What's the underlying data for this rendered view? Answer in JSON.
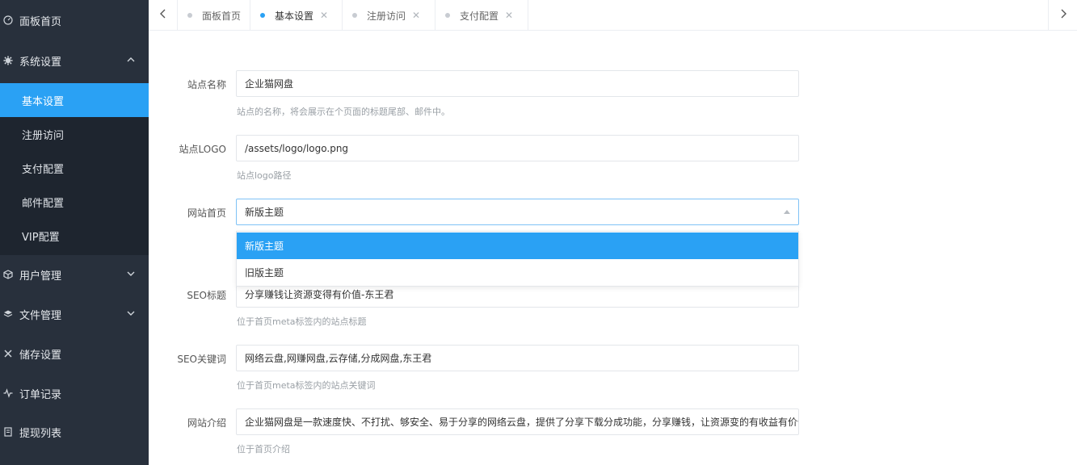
{
  "sidebar": {
    "items": [
      {
        "label": "面板首页",
        "icon": "dashboard-icon"
      },
      {
        "label": "系统设置",
        "icon": "gear-icon"
      },
      {
        "label": "用户管理",
        "icon": "box-icon"
      },
      {
        "label": "文件管理",
        "icon": "layers-icon"
      },
      {
        "label": "储存设置",
        "icon": "tools-icon"
      },
      {
        "label": "订单记录",
        "icon": "pulse-icon"
      },
      {
        "label": "提现列表",
        "icon": "document-icon"
      }
    ],
    "submenu": [
      {
        "label": "基本设置"
      },
      {
        "label": "注册访问"
      },
      {
        "label": "支付配置"
      },
      {
        "label": "邮件配置"
      },
      {
        "label": "VIP配置"
      }
    ]
  },
  "tabs": [
    {
      "label": "面板首页"
    },
    {
      "label": "基本设置"
    },
    {
      "label": "注册访问"
    },
    {
      "label": "支付配置"
    }
  ],
  "form": {
    "site_name": {
      "label": "站点名称",
      "value": "企业猫网盘",
      "help": "站点的名称，将会展示在个页面的标题尾部、邮件中。"
    },
    "site_logo": {
      "label": "站点LOGO",
      "value": "/assets/logo/logo.png",
      "help": "站点logo路径"
    },
    "homepage": {
      "label": "网站首页",
      "value": "新版主题",
      "options": [
        "新版主题",
        "旧版主题"
      ]
    },
    "seo_title": {
      "label": "SEO标题",
      "value": "分享赚钱让资源变得有价值-东王君",
      "help": "位于首页meta标签内的站点标题"
    },
    "seo_keywords": {
      "label": "SEO关键词",
      "value": "网络云盘,网赚网盘,云存储,分成网盘,东王君",
      "help": "位于首页meta标签内的站点关键词"
    },
    "site_intro": {
      "label": "网站介绍",
      "value": "企业猫网盘是一款速度快、不打扰、够安全、易于分享的网络云盘，提供了分享下载分成功能，分享赚钱，让资源变的有收益有价值",
      "help": "位于首页介绍"
    }
  },
  "colors": {
    "sidebar_bg": "#28303c",
    "accent": "#2aa1f4"
  }
}
